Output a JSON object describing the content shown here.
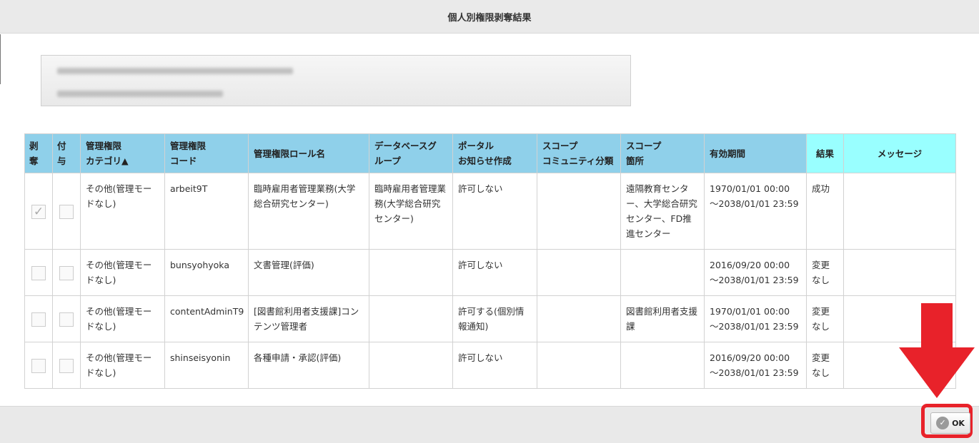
{
  "dialog": {
    "title": "個人別権限剥奪結果"
  },
  "table": {
    "headers": [
      {
        "l1": "剥",
        "l2": "奪"
      },
      {
        "l1": "付",
        "l2": "与"
      },
      {
        "l1": "管理権限",
        "l2": "カテゴリ▲"
      },
      {
        "l1": "管理権限",
        "l2": "コード"
      },
      {
        "l1": "管理権限ロール名",
        "l2": ""
      },
      {
        "l1": "データベースグ",
        "l2": "ループ"
      },
      {
        "l1": "ポータル",
        "l2": "お知らせ作成"
      },
      {
        "l1": "スコープ",
        "l2": "コミュニティ分類"
      },
      {
        "l1": "スコープ",
        "l2": "箇所"
      },
      {
        "l1": "有効期間",
        "l2": ""
      },
      {
        "l1": "結果",
        "l2": ""
      },
      {
        "l1": "メッセージ",
        "l2": ""
      }
    ],
    "rows": [
      {
        "revoke_checked": true,
        "grant_checked": false,
        "category": "その他(管理モードなし)",
        "code": "arbeit9T",
        "role": "臨時雇用者管理業務(大学総合研究センター)",
        "db_group": "臨時雇用者管理業務(大学総合研究センター)",
        "portal": "許可しない",
        "community": "",
        "scope": "遠隔教育センター、大学総合研究センター、FD推進センター",
        "period_from": "1970/01/01 00:00",
        "period_to": "～2038/01/01 23:59",
        "result": "成功",
        "message": ""
      },
      {
        "revoke_checked": false,
        "grant_checked": false,
        "category": "その他(管理モードなし)",
        "code": "bunsyohyoka",
        "role": "文書管理(評価)",
        "db_group": "",
        "portal": "許可しない",
        "community": "",
        "scope": "",
        "period_from": "2016/09/20 00:00",
        "period_to": "～2038/01/01 23:59",
        "result": "変更なし",
        "message": ""
      },
      {
        "revoke_checked": false,
        "grant_checked": false,
        "category": "その他(管理モードなし)",
        "code": "contentAdminT9",
        "role": "[図書館利用者支援課]コンテンツ管理者",
        "db_group": "",
        "portal": "許可する(個別情報通知)",
        "community": "",
        "scope": "図書館利用者支援課",
        "period_from": "1970/01/01 00:00",
        "period_to": "～2038/01/01 23:59",
        "result": "変更なし",
        "message": ""
      },
      {
        "revoke_checked": false,
        "grant_checked": false,
        "category": "その他(管理モードなし)",
        "code": "shinseisyonin",
        "role": "各種申請・承認(評価)",
        "db_group": "",
        "portal": "許可しない",
        "community": "",
        "scope": "",
        "period_from": "2016/09/20 00:00",
        "period_to": "～2038/01/01 23:59",
        "result": "変更なし",
        "message": ""
      }
    ]
  },
  "footer": {
    "ok_label": "OK"
  },
  "icons": {
    "ok": "check-circle-icon",
    "checkbox": "checkmark-icon",
    "annotation": "down-arrow-icon"
  },
  "colors": {
    "header": "#8fd0ea",
    "header_accent": "#99ffff",
    "annotation": "#e8222a"
  }
}
